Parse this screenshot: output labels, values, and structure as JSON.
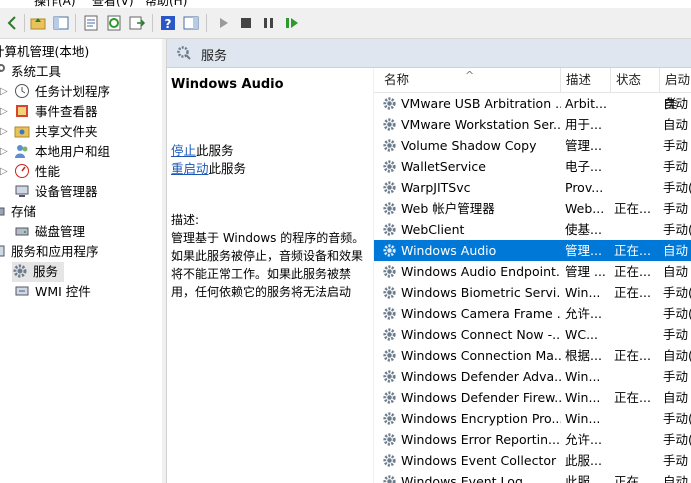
{
  "menu": [
    "操作(A)",
    "查看(V)",
    "帮助(H)"
  ],
  "tree": {
    "root": "计算机管理(本地)",
    "items": [
      "系统工具",
      "任务计划程序",
      "事件查看器",
      "共享文件夹",
      "本地用户和组",
      "性能",
      "设备管理器",
      "存储",
      "磁盘管理",
      "服务和应用程序",
      "服务",
      "WMI 控件"
    ]
  },
  "panel": {
    "title": "服务",
    "selected_name": "Windows Audio",
    "stop_link": "停止",
    "stop_suffix": "此服务",
    "restart_link": "重启动",
    "restart_suffix": "此服务",
    "desc_label": "描述:",
    "desc_text": "管理基于 Windows 的程序的音频。如果此服务被停止，音频设备和效果将不能正常工作。如果此服务被禁用，任何依赖它的服务将无法启动"
  },
  "list": {
    "headers": [
      "名称",
      "描述",
      "状态",
      "启动类"
    ],
    "rows": [
      [
        "VMware USB Arbitration ...",
        "Arbit...",
        "",
        "自动"
      ],
      [
        "VMware Workstation Ser...",
        "用于...",
        "",
        "自动"
      ],
      [
        "Volume Shadow Copy",
        "管理...",
        "",
        "手动"
      ],
      [
        "WalletService",
        "电子...",
        "",
        "手动"
      ],
      [
        "WarpJITSvc",
        "Prov...",
        "",
        "手动("
      ],
      [
        "Web 帐户管理器",
        "Web...",
        "正在...",
        "手动"
      ],
      [
        "WebClient",
        "使基...",
        "",
        "手动("
      ],
      [
        "Windows Audio",
        "管理...",
        "正在...",
        "自动"
      ],
      [
        "Windows Audio Endpoint...",
        "管理 ...",
        "正在...",
        "自动"
      ],
      [
        "Windows Biometric Servi...",
        "Win...",
        "正在...",
        "手动("
      ],
      [
        "Windows Camera Frame ...",
        "允许...",
        "",
        "手动("
      ],
      [
        "Windows Connect Now -...",
        "WC...",
        "",
        "手动"
      ],
      [
        "Windows Connection Ma...",
        "根据...",
        "正在...",
        "自动("
      ],
      [
        "Windows Defender Adva...",
        "Win...",
        "",
        "手动"
      ],
      [
        "Windows Defender Firew...",
        "Win...",
        "正在...",
        "自动"
      ],
      [
        "Windows Encryption Pro...",
        "Win...",
        "",
        "手动("
      ],
      [
        "Windows Error Reportin...",
        "允许...",
        "",
        "手动("
      ],
      [
        "Windows Event Collector",
        "此服...",
        "",
        "手动"
      ],
      [
        "Windows Event Log",
        "此服...",
        "正在...",
        "自动"
      ]
    ],
    "selected_index": 7
  }
}
